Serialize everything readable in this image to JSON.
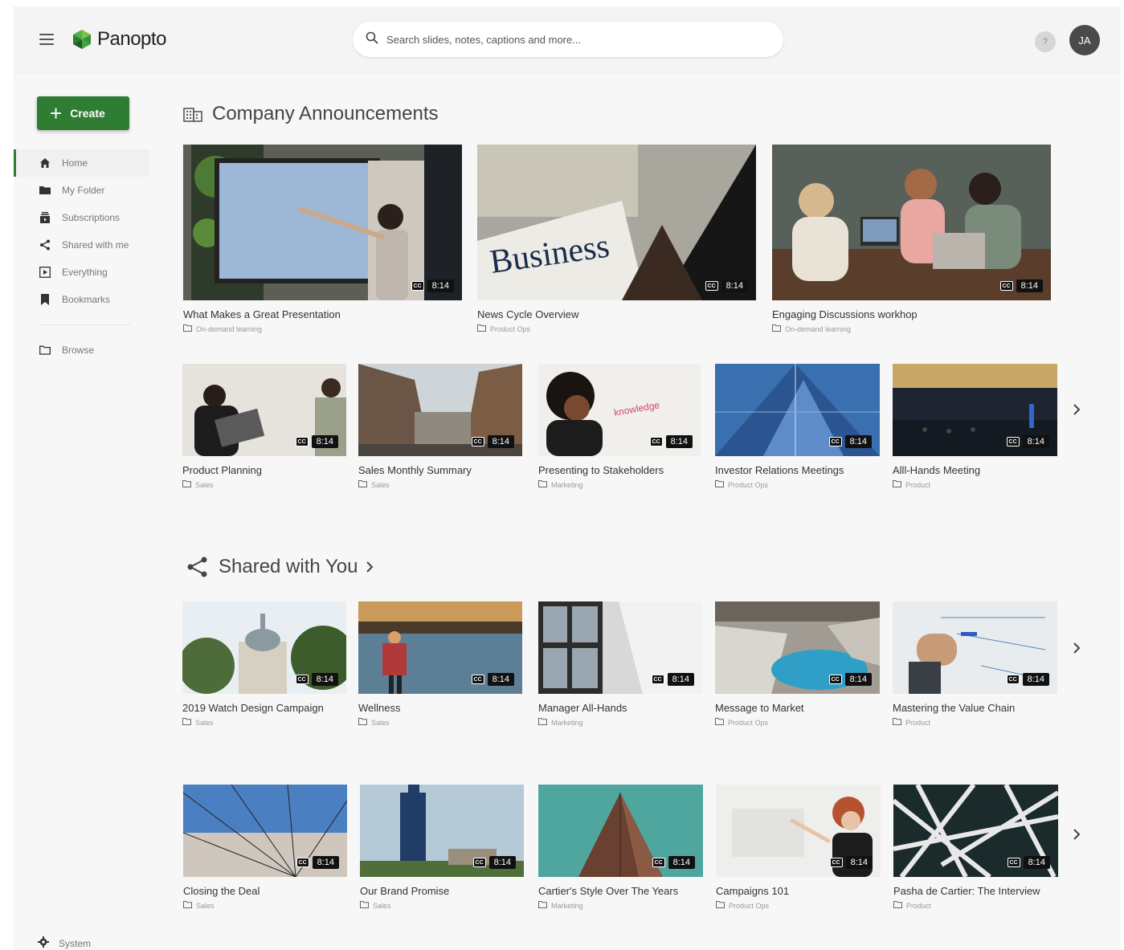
{
  "app": {
    "name": "Panopto"
  },
  "search": {
    "placeholder": "Search slides, notes, captions and more..."
  },
  "header": {
    "help": "?",
    "avatar_initials": "JA"
  },
  "sidebar": {
    "create_label": "Create",
    "items": [
      {
        "label": "Home",
        "icon": "home-icon"
      },
      {
        "label": "My Folder",
        "icon": "folder-icon"
      },
      {
        "label": "Subscriptions",
        "icon": "subscriptions-icon"
      },
      {
        "label": "Shared with me",
        "icon": "share-icon"
      },
      {
        "label": "Everything",
        "icon": "everything-icon"
      },
      {
        "label": "Bookmarks",
        "icon": "bookmark-icon"
      }
    ],
    "browse_label": "Browse",
    "system_label": "System"
  },
  "sections": {
    "announcements": {
      "title": "Company Announcements",
      "featured": [
        {
          "title": "What Makes a Great Presentation",
          "folder": "On-demand learning",
          "duration": "8:14"
        },
        {
          "title": "News Cycle Overview",
          "folder": "Product Ops",
          "duration": "8:14"
        },
        {
          "title": "Engaging Discussions workhop",
          "folder": "On-demand learning",
          "duration": "8:14"
        }
      ],
      "row": [
        {
          "title": "Product Planning",
          "folder": "Sales",
          "duration": "8:14"
        },
        {
          "title": "Sales Monthly Summary",
          "folder": "Sales",
          "duration": "8:14"
        },
        {
          "title": "Presenting to Stakeholders",
          "folder": "Marketing",
          "duration": "8:14"
        },
        {
          "title": "Investor Relations Meetings",
          "folder": "Product Ops",
          "duration": "8:14"
        },
        {
          "title": "Alll-Hands Meeting",
          "folder": "Product",
          "duration": "8:14"
        }
      ]
    },
    "shared": {
      "title": "Shared with You",
      "row1": [
        {
          "title": "2019 Watch Design Campaign",
          "folder": "Sales",
          "duration": "8:14"
        },
        {
          "title": "Wellness",
          "folder": "Sales",
          "duration": "8:14"
        },
        {
          "title": "Manager All-Hands",
          "folder": "Marketing",
          "duration": "8:14"
        },
        {
          "title": "Message to Market",
          "folder": "Product Ops",
          "duration": "8:14"
        },
        {
          "title": "Mastering the Value Chain",
          "folder": "Product",
          "duration": "8:14"
        }
      ],
      "row2": [
        {
          "title": "Closing the Deal",
          "folder": "Sales",
          "duration": "8:14"
        },
        {
          "title": "Our Brand Promise",
          "folder": "Sales",
          "duration": "8:14"
        },
        {
          "title": "Cartier's Style Over The Years",
          "folder": "Marketing",
          "duration": "8:14"
        },
        {
          "title": "Campaigns 101",
          "folder": "Product Ops",
          "duration": "8:14"
        },
        {
          "title": "Pasha de Cartier: The Interview",
          "folder": "Product",
          "duration": "8:14"
        }
      ]
    }
  },
  "colors": {
    "accent": "#2e7d32",
    "background": "#f7f7f7"
  }
}
